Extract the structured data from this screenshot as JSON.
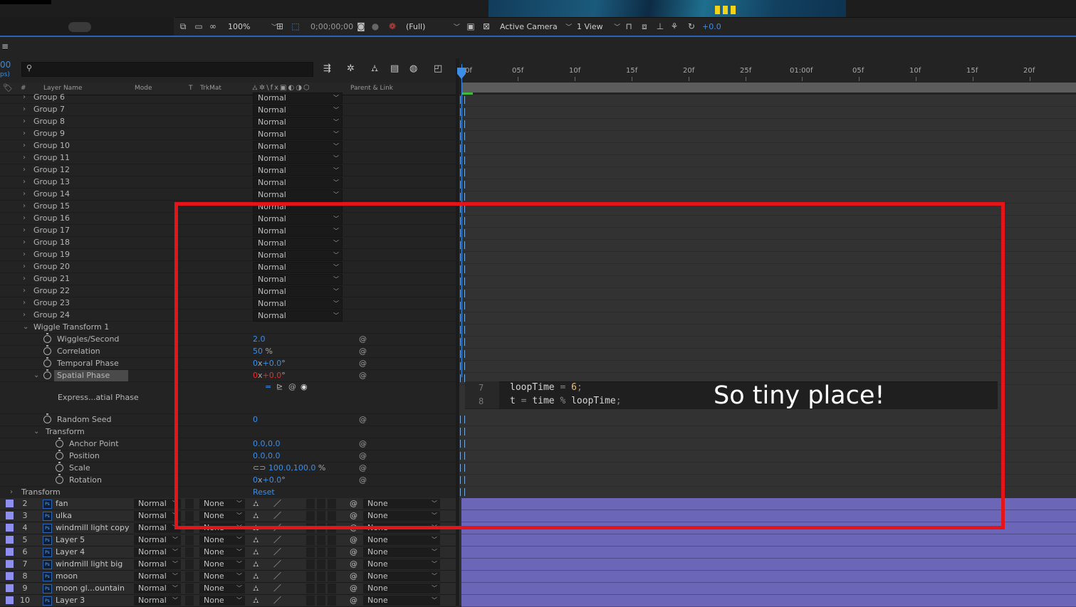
{
  "viewer_toolbar": {
    "zoom": "100%",
    "timecode": "0;00;00;00",
    "resolution": "(Full)",
    "camera": "Active Camera",
    "view": "1 View",
    "exposure": "+0.0"
  },
  "timeline": {
    "time_display": "00",
    "fps_hint": "ps)",
    "search_placeholder": "",
    "columns": {
      "num": "#",
      "layer_name": "Layer Name",
      "mode": "Mode",
      "t": "T",
      "trkmat": "TrkMat",
      "parent": "Parent & Link"
    },
    "ruler": [
      "0f",
      "05f",
      "10f",
      "15f",
      "20f",
      "25f",
      "01:00f",
      "05f",
      "10f",
      "15f",
      "20f"
    ]
  },
  "groups": [
    {
      "name": "Group 6",
      "mode": "Normal"
    },
    {
      "name": "Group 7",
      "mode": "Normal"
    },
    {
      "name": "Group 8",
      "mode": "Normal"
    },
    {
      "name": "Group 9",
      "mode": "Normal"
    },
    {
      "name": "Group 10",
      "mode": "Normal"
    },
    {
      "name": "Group 11",
      "mode": "Normal"
    },
    {
      "name": "Group 12",
      "mode": "Normal"
    },
    {
      "name": "Group 13",
      "mode": "Normal"
    },
    {
      "name": "Group 14",
      "mode": "Normal"
    },
    {
      "name": "Group 15",
      "mode": "Normal"
    },
    {
      "name": "Group 16",
      "mode": "Normal"
    },
    {
      "name": "Group 17",
      "mode": "Normal"
    },
    {
      "name": "Group 18",
      "mode": "Normal"
    },
    {
      "name": "Group 19",
      "mode": "Normal"
    },
    {
      "name": "Group 20",
      "mode": "Normal"
    },
    {
      "name": "Group 21",
      "mode": "Normal"
    },
    {
      "name": "Group 22",
      "mode": "Normal"
    },
    {
      "name": "Group 23",
      "mode": "Normal"
    },
    {
      "name": "Group 24",
      "mode": "Normal"
    }
  ],
  "wiggle": {
    "title": "Wiggle Transform 1",
    "wiggles_label": "Wiggles/Second",
    "wiggles_value": "2.0",
    "correlation_label": "Correlation",
    "correlation_value": "50",
    "correlation_unit": "%",
    "temporal_label": "Temporal Phase",
    "temporal_rev": "0",
    "temporal_x": "x",
    "temporal_deg": "+0.0",
    "temporal_unit": "°",
    "spatial_label": "Spatial Phase",
    "spatial_rev": "0",
    "spatial_x": "x",
    "spatial_deg": "+0.0",
    "spatial_unit": "°",
    "expression_label": "Express...atial Phase",
    "seed_label": "Random Seed",
    "seed_value": "0",
    "transform_label": "Transform",
    "anchor_label": "Anchor Point",
    "anchor_value": "0.0,0.0",
    "position_label": "Position",
    "position_value": "0.0,0.0",
    "scale_label": "Scale",
    "scale_value": "100.0,100.0",
    "scale_unit": "%",
    "rotation_label": "Rotation",
    "rotation_rev": "0",
    "rotation_x": "x",
    "rotation_deg": "+0.0",
    "rotation_unit": "°"
  },
  "outer_transform": {
    "label": "Transform",
    "reset": "Reset"
  },
  "layers": [
    {
      "num": "2",
      "name": "fan",
      "mode": "Normal",
      "trkmat": "None",
      "parent": "None"
    },
    {
      "num": "3",
      "name": "ulka",
      "mode": "Normal",
      "trkmat": "None",
      "parent": "None"
    },
    {
      "num": "4",
      "name": "windmill light copy",
      "mode": "Normal",
      "trkmat": "None",
      "parent": "None"
    },
    {
      "num": "5",
      "name": "Layer 5",
      "mode": "Normal",
      "trkmat": "None",
      "parent": "None"
    },
    {
      "num": "6",
      "name": "Layer 4",
      "mode": "Normal",
      "trkmat": "None",
      "parent": "None"
    },
    {
      "num": "7",
      "name": "windmill light big",
      "mode": "Normal",
      "trkmat": "None",
      "parent": "None"
    },
    {
      "num": "8",
      "name": "moon",
      "mode": "Normal",
      "trkmat": "None",
      "parent": "None"
    },
    {
      "num": "9",
      "name": "moon gl...ountain",
      "mode": "Normal",
      "trkmat": "None",
      "parent": "None"
    },
    {
      "num": "10",
      "name": "Layer 3",
      "mode": "Normal",
      "trkmat": "None",
      "parent": "None"
    }
  ],
  "expression": {
    "line7_num": "7",
    "line8_num": "8",
    "line7_a": "loopTime",
    "line7_op": "=",
    "line7_val": "6",
    "line7_end": ";",
    "line8_a": "t",
    "line8_op": "=",
    "line8_b": "time",
    "line8_mod": "%",
    "line8_c": "loopTime",
    "line8_end": ";"
  },
  "annotation": {
    "text": "So tiny place!",
    "box_color": "#e3141a",
    "text_color": "#ffffff"
  },
  "colors": {
    "accent_blue": "#3d8ee8",
    "layer_bar": "#6c66b8",
    "layer_swatch": "#8f8ff0",
    "expression_red": "#e53030"
  }
}
